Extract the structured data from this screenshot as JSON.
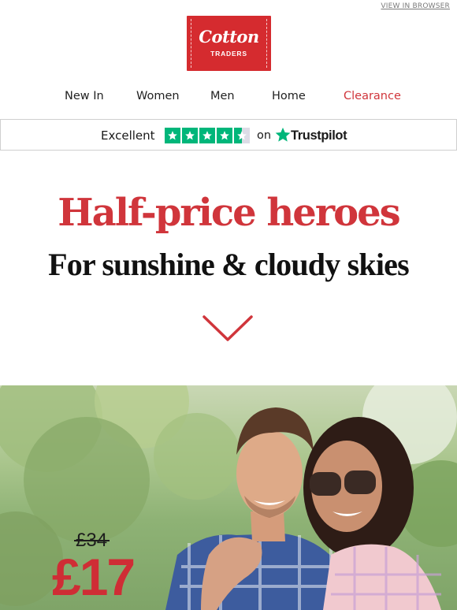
{
  "header": {
    "view_in_browser": "VIEW IN BROWSER",
    "logo": {
      "main": "Cotton",
      "sub": "TRADERS",
      "color": "#d52b2f"
    }
  },
  "nav": {
    "items": [
      {
        "label": "New In"
      },
      {
        "label": "Women"
      },
      {
        "label": "Men"
      },
      {
        "label": "Home"
      },
      {
        "label": "Clearance",
        "color": "#d0353b"
      }
    ]
  },
  "trustpilot": {
    "rating_text": "Excellent",
    "stars": 4.5,
    "on_text": "on",
    "brand": "Trustpilot",
    "star_color": "#00b67a"
  },
  "hero": {
    "headline": "Half-price heroes",
    "subhead": "For sunshine & cloudy skies",
    "headline_color": "#d0353b",
    "chevron_icon": "chevron-down-icon"
  },
  "promo": {
    "old_price": "£34",
    "new_price": "£17",
    "price_color": "#cf2d35"
  }
}
